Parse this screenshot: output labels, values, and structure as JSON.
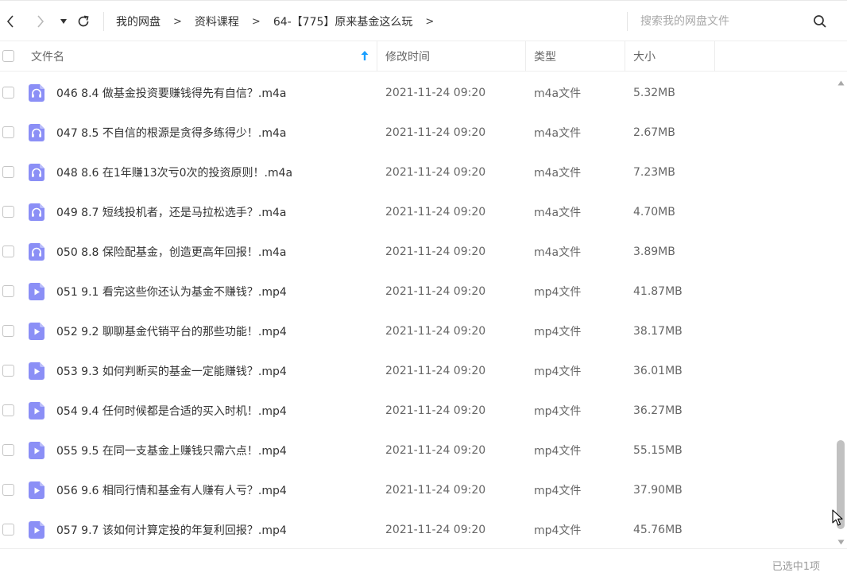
{
  "toolbar": {
    "back_icon": "chevron-left-icon",
    "forward_icon": "chevron-right-icon",
    "history_icon": "caret-down-icon",
    "refresh_icon": "refresh-icon",
    "breadcrumb": [
      "我的网盘",
      "资料课程",
      "64-【775】原来基金这么玩"
    ],
    "breadcrumb_separator": ">",
    "search_placeholder": "搜索我的网盘文件",
    "search_icon": "search-icon"
  },
  "columns": {
    "name": "文件名",
    "modified": "修改时间",
    "type": "类型",
    "size": "大小",
    "sort_icon": "sort-ascending-arrow-icon"
  },
  "files": [
    {
      "name": "046 8.4 做基金投资要赚钱得先有自信？.m4a",
      "modified": "2021-11-24 09:20",
      "type": "m4a文件",
      "size": "5.32MB",
      "icon": "audio"
    },
    {
      "name": "047 8.5 不自信的根源是贪得多练得少！.m4a",
      "modified": "2021-11-24 09:20",
      "type": "m4a文件",
      "size": "2.67MB",
      "icon": "audio"
    },
    {
      "name": "048 8.6 在1年赚13次亏0次的投资原则！.m4a",
      "modified": "2021-11-24 09:20",
      "type": "m4a文件",
      "size": "7.23MB",
      "icon": "audio"
    },
    {
      "name": "049 8.7 短线投机者，还是马拉松选手？.m4a",
      "modified": "2021-11-24 09:20",
      "type": "m4a文件",
      "size": "4.70MB",
      "icon": "audio"
    },
    {
      "name": "050 8.8 保险配基金，创造更高年回报！.m4a",
      "modified": "2021-11-24 09:20",
      "type": "m4a文件",
      "size": "3.89MB",
      "icon": "audio"
    },
    {
      "name": "051 9.1 看完这些你还认为基金不赚钱？.mp4",
      "modified": "2021-11-24 09:20",
      "type": "mp4文件",
      "size": "41.87MB",
      "icon": "video"
    },
    {
      "name": "052 9.2 聊聊基金代销平台的那些功能！.mp4",
      "modified": "2021-11-24 09:20",
      "type": "mp4文件",
      "size": "38.17MB",
      "icon": "video"
    },
    {
      "name": "053 9.3 如何判断买的基金一定能赚钱？.mp4",
      "modified": "2021-11-24 09:20",
      "type": "mp4文件",
      "size": "36.01MB",
      "icon": "video"
    },
    {
      "name": "054 9.4 任何时候都是合适的买入时机！.mp4",
      "modified": "2021-11-24 09:20",
      "type": "mp4文件",
      "size": "36.27MB",
      "icon": "video"
    },
    {
      "name": "055 9.5 在同一支基金上赚钱只需六点！.mp4",
      "modified": "2021-11-24 09:20",
      "type": "mp4文件",
      "size": "55.15MB",
      "icon": "video"
    },
    {
      "name": "056 9.6 相同行情和基金有人赚有人亏？.mp4",
      "modified": "2021-11-24 09:20",
      "type": "mp4文件",
      "size": "37.90MB",
      "icon": "video"
    },
    {
      "name": "057 9.7 该如何计算定投的年复利回报？.mp4",
      "modified": "2021-11-24 09:20",
      "type": "mp4文件",
      "size": "45.76MB",
      "icon": "video"
    }
  ],
  "footer": {
    "selection_status": "已选中1项"
  },
  "scroll": {
    "position_fraction": 0.82
  },
  "colors": {
    "file_icon": "#8b8ff6",
    "file_icon_glyph": "#ffffff",
    "sort_arrow": "#1a9fff",
    "scroll_thumb": "#c1c1c1"
  }
}
